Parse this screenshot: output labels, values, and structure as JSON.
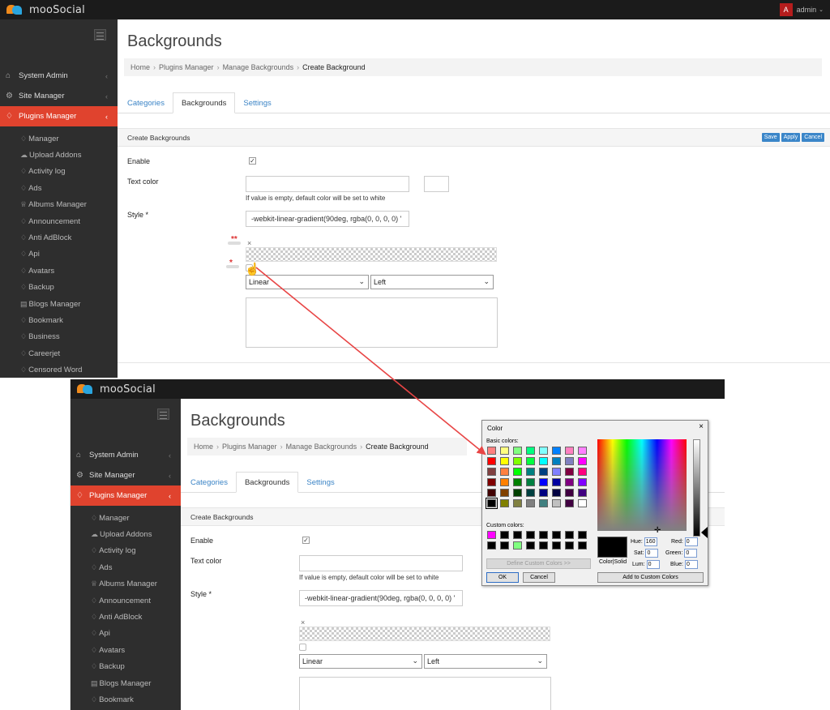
{
  "app": {
    "logo_text": "mooSocial",
    "user_initial": "A",
    "user_name": "admin"
  },
  "sidebar": {
    "main_items": [
      {
        "label": "System Admin",
        "icon": "home-icon"
      },
      {
        "label": "Site Manager",
        "icon": "gears-icon"
      },
      {
        "label": "Plugins Manager",
        "icon": "tag-icon"
      }
    ],
    "sub_items": [
      {
        "label": "Manager",
        "icon": "tag-icon"
      },
      {
        "label": "Upload Addons",
        "icon": "cloud-upload-icon"
      },
      {
        "label": "Activity log",
        "icon": "tag-icon"
      },
      {
        "label": "Ads",
        "icon": "tag-icon"
      },
      {
        "label": "Albums Manager",
        "icon": "trophy-icon"
      },
      {
        "label": "Announcement",
        "icon": "tag-icon"
      },
      {
        "label": "Anti AdBlock",
        "icon": "tag-icon"
      },
      {
        "label": "Api",
        "icon": "tag-icon"
      },
      {
        "label": "Avatars",
        "icon": "tag-icon"
      },
      {
        "label": "Backup",
        "icon": "tag-icon"
      },
      {
        "label": "Blogs Manager",
        "icon": "chat-icon"
      },
      {
        "label": "Bookmark",
        "icon": "tag-icon"
      },
      {
        "label": "Business",
        "icon": "tag-icon"
      },
      {
        "label": "Careerjet",
        "icon": "tag-icon"
      },
      {
        "label": "Censored Word",
        "icon": "tag-icon"
      }
    ]
  },
  "page": {
    "title": "Backgrounds",
    "breadcrumb": {
      "home": "Home",
      "plugins": "Plugins Manager",
      "manage": "Manage Backgrounds",
      "current": "Create Background"
    },
    "tabs": [
      "Categories",
      "Backgrounds",
      "Settings"
    ]
  },
  "panel": {
    "title": "Create Backgrounds",
    "save_label": "Save",
    "apply_label": "Apply",
    "cancel_label": "Cancel"
  },
  "form": {
    "enable_label": "Enable",
    "enable_checked": "✓",
    "text_color_label": "Text color",
    "text_color_value": "",
    "text_color_hint": "If value is empty, default color will be set to white",
    "style_label": "Style *",
    "style_value": "-webkit-linear-gradient(90deg, rgba(0, 0, 0, 0) '",
    "gradient_type": "Linear",
    "gradient_direction": "Left",
    "remove_mark": "×"
  },
  "annotations": {
    "double_star": "**",
    "single_star": "*"
  },
  "color_dialog": {
    "title": "Color",
    "close": "×",
    "basic_label": "Basic colors:",
    "custom_label": "Custom colors:",
    "define_label": "Define Custom Colors >>",
    "ok_label": "OK",
    "cancel_label": "Cancel",
    "add_label": "Add to Custom Colors",
    "color_solid_label": "Color|Solid",
    "hue_label": "Hue:",
    "hue_value": "160",
    "sat_label": "Sat:",
    "sat_value": "0",
    "lum_label": "Lum:",
    "lum_value": "0",
    "red_label": "Red:",
    "red_value": "0",
    "green_label": "Green:",
    "green_value": "0",
    "blue_label": "Blue:",
    "blue_value": "0",
    "basic_colors": [
      "#ff8080",
      "#ffff80",
      "#80ff80",
      "#00ff80",
      "#80ffff",
      "#0080ff",
      "#ff80c0",
      "#ff80ff",
      "#ff0000",
      "#ffff00",
      "#80ff00",
      "#00ff40",
      "#00ffff",
      "#0080c0",
      "#8080c0",
      "#ff00ff",
      "#804040",
      "#ff8040",
      "#00ff00",
      "#008080",
      "#004080",
      "#8080ff",
      "#800040",
      "#ff0080",
      "#800000",
      "#ff8000",
      "#008000",
      "#008040",
      "#0000ff",
      "#0000a0",
      "#800080",
      "#8000ff",
      "#400000",
      "#804000",
      "#004000",
      "#004040",
      "#000080",
      "#000040",
      "#400040",
      "#400080",
      "#000000",
      "#808000",
      "#808040",
      "#808080",
      "#408080",
      "#c0c0c0",
      "#400040",
      "#ffffff"
    ],
    "custom_colors": [
      "#ff00ff",
      "#000000",
      "#000000",
      "#000000",
      "#000000",
      "#000000",
      "#000000",
      "#000000",
      "#000000",
      "#000000",
      "#80ff80",
      "#000000",
      "#000000",
      "#000000",
      "#000000",
      "#000000"
    ]
  },
  "colors": {
    "accent_red": "#e0432e",
    "link_blue": "#3b84c6",
    "sidebar_bg": "#2e2e2e",
    "topbar_bg": "#1b1b1b",
    "arrow": "#e84545"
  }
}
